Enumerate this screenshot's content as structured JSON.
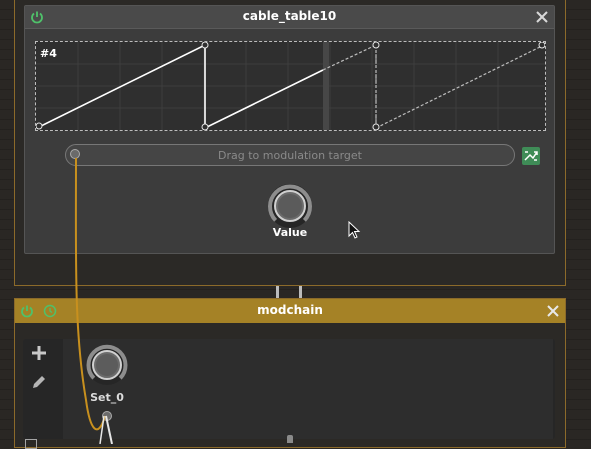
{
  "cable_panel": {
    "title": "cable_table10",
    "graph_label": "#4",
    "drag_text": "Drag to modulation target",
    "knob": {
      "label": "Value",
      "level": 0.85
    }
  },
  "modchain": {
    "title": "modchain",
    "knob": {
      "label": "Set_0",
      "level": 0.8
    }
  },
  "colors": {
    "accent_gold": "#a58226",
    "power_green": "#4fc16a",
    "cable_orange": "#c8901e"
  },
  "icons": [
    "power-icon",
    "close-icon",
    "add-icon",
    "pencil-icon",
    "clock-icon",
    "shuffle-icon",
    "pointer-cursor-icon"
  ]
}
